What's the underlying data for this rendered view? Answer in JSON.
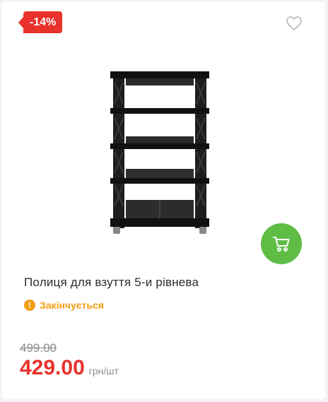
{
  "badge": {
    "discount": "-14%"
  },
  "product": {
    "title": "Полиця для взуття 5-и рівнева",
    "status": "Закінчується",
    "old_price": "499.00",
    "price": "429.00",
    "unit": "грн/шт"
  },
  "colors": {
    "accent_red": "#e8322b",
    "cart_green": "#5fbd46",
    "warning_orange": "#f39c12"
  },
  "icons": {
    "favorite": "heart-outline-icon",
    "cart": "shopping-cart-icon",
    "status": "exclamation-icon"
  }
}
